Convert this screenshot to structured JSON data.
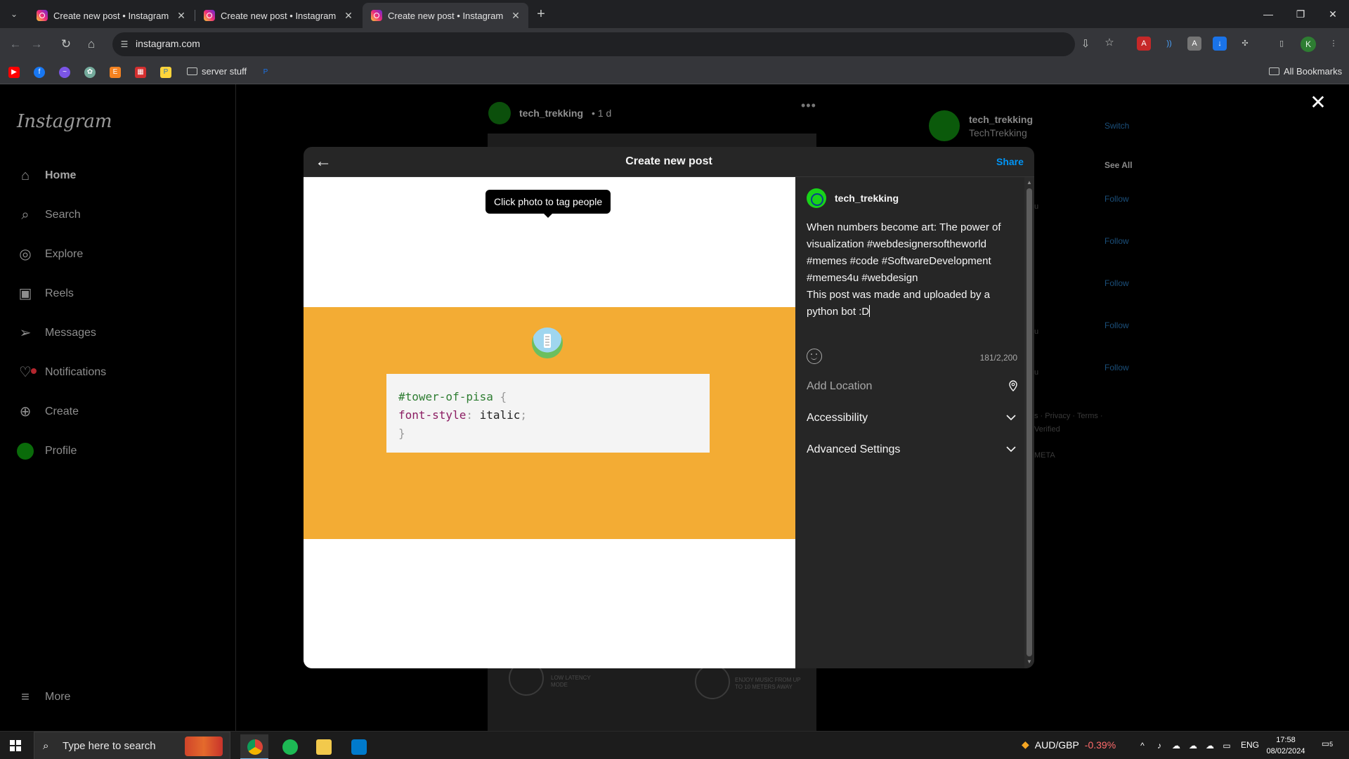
{
  "browser": {
    "tabs": [
      {
        "title": "Create new post • Instagram",
        "close": "✕"
      },
      {
        "title": "Create new post • Instagram",
        "close": "✕"
      },
      {
        "title": "Create new post • Instagram",
        "close": "✕"
      }
    ],
    "new_tab": "+",
    "url": "instagram.com",
    "window_controls": {
      "minimize": "—",
      "restore": "❐",
      "close": "✕"
    },
    "profile_initial": "K",
    "bookmarks": {
      "folder": "server stuff",
      "all": "All Bookmarks"
    }
  },
  "instagram": {
    "logo": "Instagram",
    "nav": [
      {
        "label": "Home",
        "icon": "home-icon"
      },
      {
        "label": "Search",
        "icon": "search-icon"
      },
      {
        "label": "Explore",
        "icon": "compass-icon"
      },
      {
        "label": "Reels",
        "icon": "reels-icon"
      },
      {
        "label": "Messages",
        "icon": "messages-icon"
      },
      {
        "label": "Notifications",
        "icon": "heart-icon"
      },
      {
        "label": "Create",
        "icon": "plus-square-icon"
      },
      {
        "label": "Profile",
        "icon": "avatar"
      }
    ],
    "more_label": "More",
    "feed": {
      "username": "tech_trekking",
      "time": "• 1 d",
      "more": "•••",
      "image_caption_1": "LOW LATENCY MODE",
      "image_caption_2": "ENJOY MUSIC FROM UP TO 10 METERS AWAY"
    },
    "suggestions": {
      "username": "tech_trekking",
      "fullname": "TechTrekking",
      "switch": "Switch",
      "see_all": "See All",
      "follow": "Follow",
      "footer_1": "s · Privacy · Terms ·",
      "footer_2": "Verified",
      "footer_3": "META",
      "side_frag": "u"
    }
  },
  "modal": {
    "title": "Create new post",
    "share": "Share",
    "tooltip": "Click photo to tag people",
    "code": {
      "selector": "#tower-of-pisa",
      "open_brace": "{",
      "property": "font-style",
      "colon": ":",
      "value": "italic",
      "semicolon": ";",
      "close_brace": "}"
    },
    "username": "tech_trekking",
    "caption": "When numbers become art: The power of visualization #webdesignersoftheworld #memes #code #SoftwareDevelopment #memes4u #webdesign\nThis post was made and uploaded by a python bot :D",
    "char_count": "181/2,200",
    "add_location": "Add Location",
    "accessibility": "Accessibility",
    "advanced_settings": "Advanced Settings"
  },
  "taskbar": {
    "search_placeholder": "Type here to search",
    "ticker": "AUD/GBP",
    "ticker_change": "-0.39%",
    "lang": "ENG",
    "time": "17:58",
    "date": "08/02/2024",
    "notifications": "5"
  },
  "colors": {
    "accent": "#0095f6",
    "orange": "#f3ac34",
    "modal_bg": "#262626"
  }
}
